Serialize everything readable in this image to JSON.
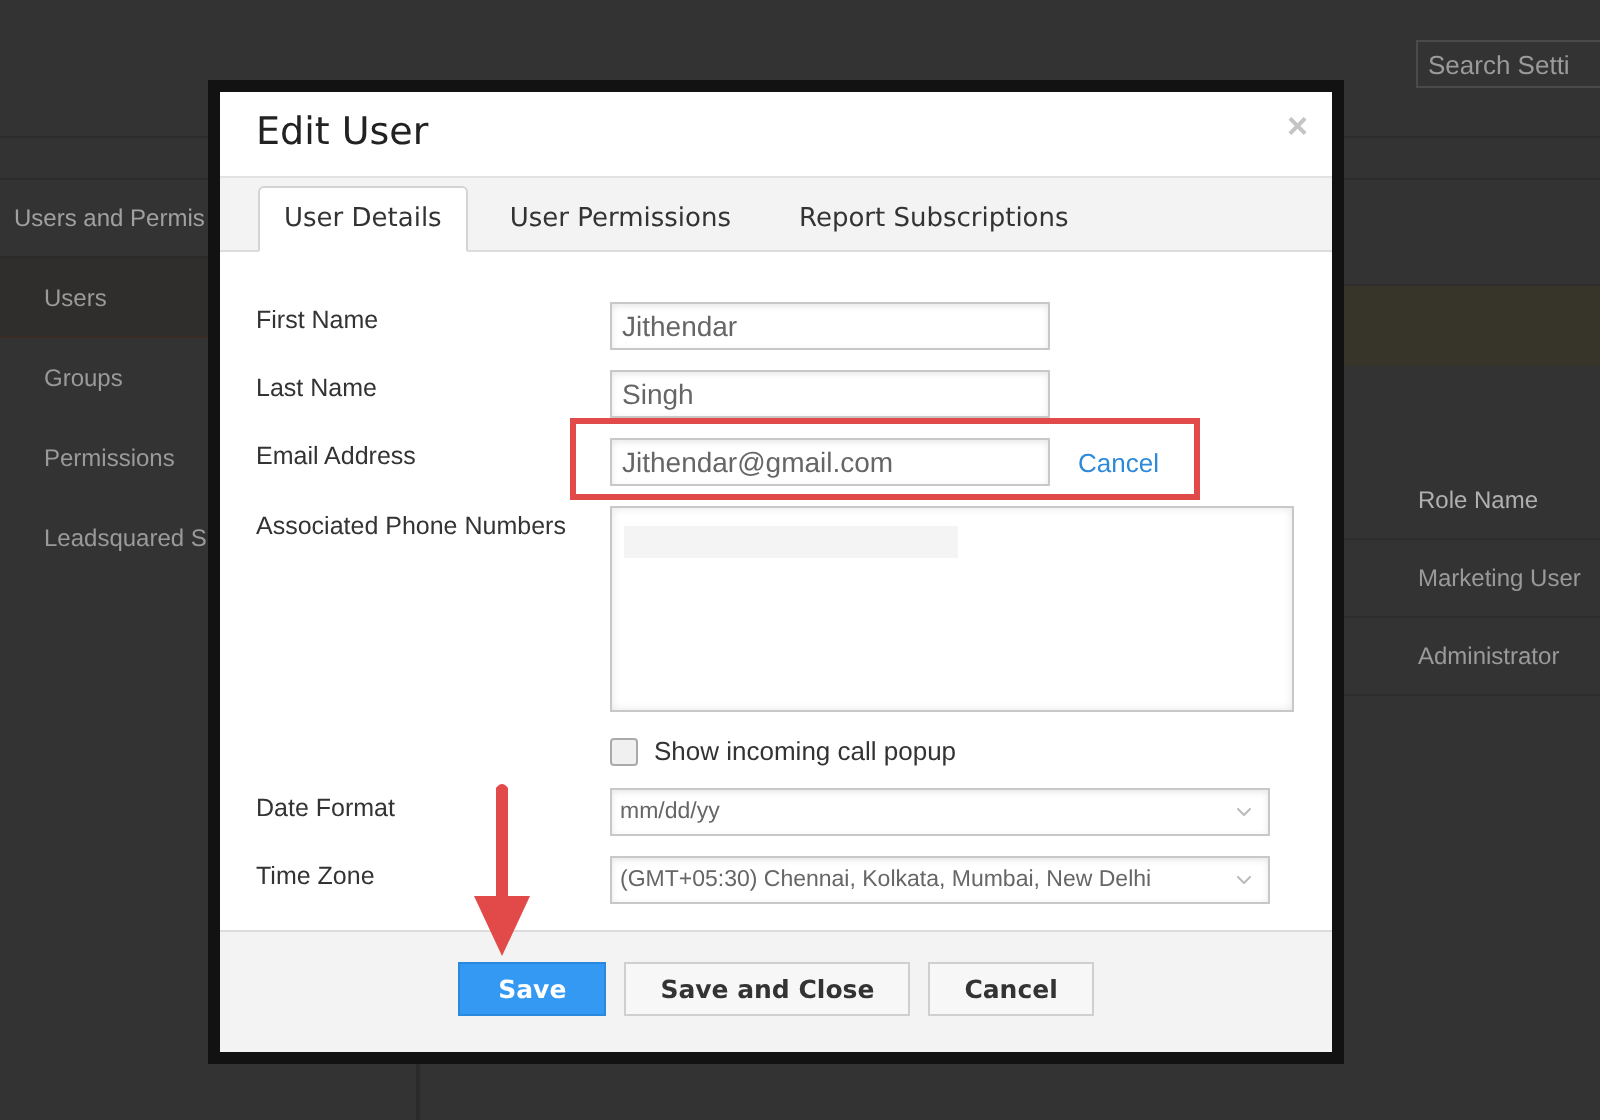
{
  "background_page": {
    "search": {
      "placeholder": "Search Setti"
    },
    "sidebar": {
      "heading": "Users and Permis",
      "items": [
        {
          "label": "Users",
          "selected": true
        },
        {
          "label": "Groups",
          "selected": false
        },
        {
          "label": "Permissions",
          "selected": false
        },
        {
          "label": "Leadsquared S",
          "selected": false
        }
      ]
    },
    "table": {
      "columns": [
        "Role Name"
      ],
      "rows": [
        [
          "Marketing User"
        ],
        [
          "Administrator"
        ]
      ]
    }
  },
  "dialog": {
    "title": "Edit User",
    "close": "×",
    "tabs": [
      {
        "label": "User Details",
        "selected": true
      },
      {
        "label": "User Permissions",
        "selected": false
      },
      {
        "label": "Report Subscriptions",
        "selected": false
      }
    ],
    "fields": [
      {
        "kind": "text",
        "label": "First Name",
        "value": "Jithendar"
      },
      {
        "kind": "text",
        "label": "Last Name",
        "value": "Singh"
      },
      {
        "kind": "text",
        "label": "Email Address",
        "value": "Jithendar@gmail.com",
        "link": "Cancel",
        "highlighted": true
      },
      {
        "kind": "textarea",
        "label": "Associated Phone Numbers"
      },
      {
        "kind": "checkbox",
        "label": "Show incoming call popup",
        "checked": false
      },
      {
        "kind": "select",
        "label": "Date Format",
        "value": "mm/dd/yy"
      },
      {
        "kind": "select",
        "label": "Time Zone",
        "value": "(GMT+05:30) Chennai, Kolkata, Mumbai, New Delhi"
      }
    ],
    "buttons": [
      {
        "label": "Save",
        "primary": true,
        "pointed": true
      },
      {
        "label": "Save and Close",
        "primary": false,
        "pointed": false
      },
      {
        "label": "Cancel",
        "primary": false,
        "pointed": false
      }
    ]
  }
}
